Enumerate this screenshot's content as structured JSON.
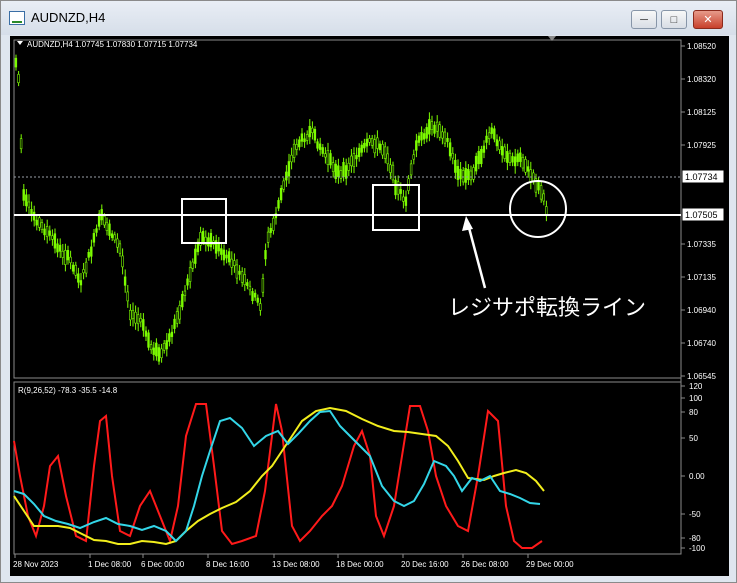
{
  "window": {
    "title": "AUDNZD,H4",
    "controls": [
      "minimize-icon",
      "maximize-icon",
      "close-icon"
    ]
  },
  "main_chart": {
    "header": "AUDNZD,H4  1.07745 1.07830 1.07715 1.07734",
    "price_scale": [
      "1.08520",
      "1.08320",
      "1.08125",
      "1.07925",
      "1.07734",
      "1.07505",
      "1.07335",
      "1.07135",
      "1.06940",
      "1.06740",
      "1.06545"
    ],
    "current_price": "1.07734",
    "line_price": "1.07505",
    "annotation": "レジサポ転換ライン",
    "colors": {
      "candles": "#7cfc00",
      "line": "#ffffff",
      "boxes": "#ffffff",
      "current_line": "#c0c0c0"
    }
  },
  "oscillator": {
    "header": "R(9,26,52) -78.3 -35.5 -14.8",
    "scale": [
      "120",
      "100",
      "80",
      "50",
      "0.00",
      "-50",
      "-80",
      "-100"
    ],
    "colors": {
      "fast": "#ff1a1a",
      "mid": "#33d6e8",
      "slow": "#f2ee1c"
    }
  },
  "time_axis": [
    "28 Nov 2023",
    "1 Dec 08:00",
    "6 Dec 00:00",
    "8 Dec 16:00",
    "13 Dec 08:00",
    "18 Dec 00:00",
    "20 Dec 16:00",
    "26 Dec 08:00",
    "29 Dec 00:00"
  ]
}
